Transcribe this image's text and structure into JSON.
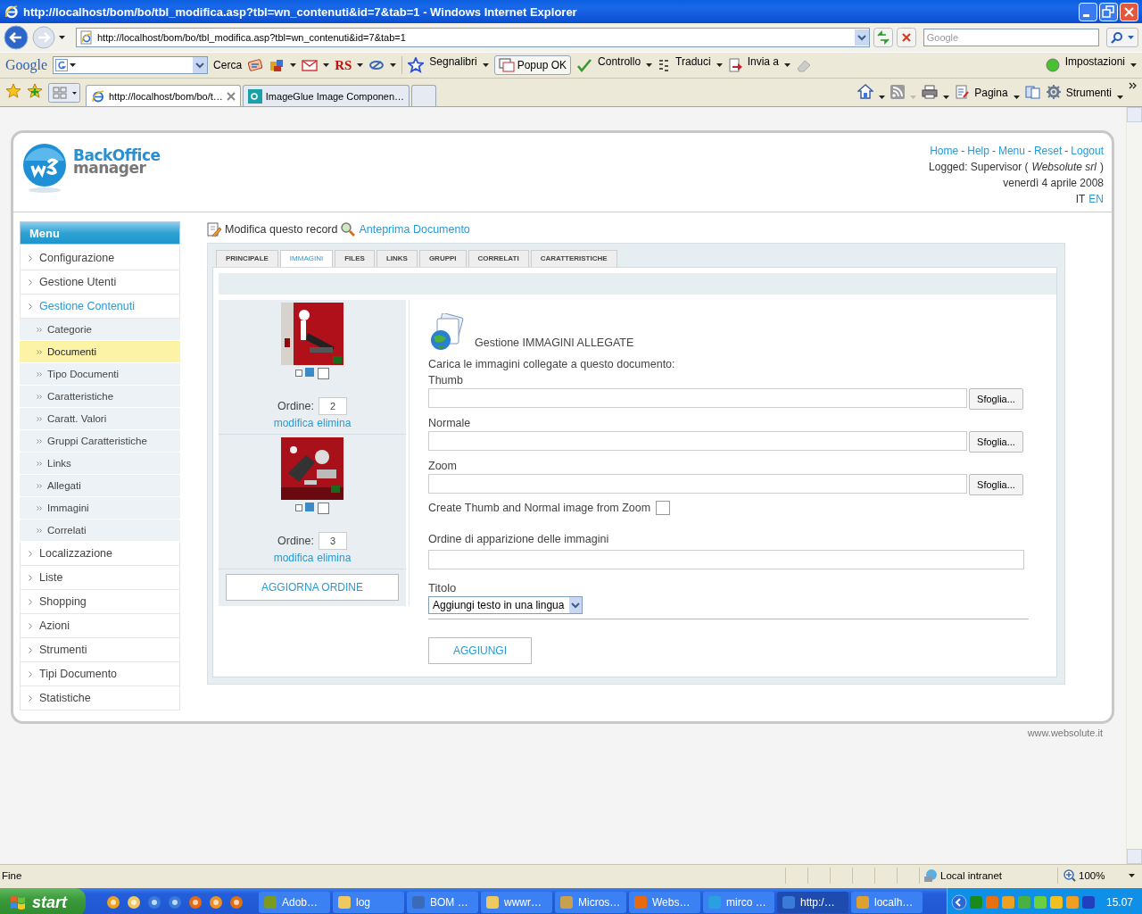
{
  "window": {
    "title": "http://localhost/bom/bo/tbl_modifica.asp?tbl=wn_contenuti&id=7&tab=1 - Windows Internet Explorer"
  },
  "nav": {
    "address": "http://localhost/bom/bo/tbl_modifica.asp?tbl=wn_contenuti&id=7&tab=1",
    "search_placeholder": "Google"
  },
  "google_toolbar": {
    "logo": "Google",
    "search_button": "Cerca",
    "rs": "RS",
    "items": [
      {
        "label": "Segnalibri",
        "kind": "menu"
      },
      {
        "label": "Popup OK",
        "kind": "button"
      },
      {
        "label": "Controllo",
        "kind": "menu"
      },
      {
        "label": "Traduci",
        "kind": "menu"
      },
      {
        "label": "Invia a",
        "kind": "menu"
      }
    ],
    "settings": "Impostazioni"
  },
  "tabs": [
    {
      "label": "http://localhost/bom/bo/t…",
      "selected": true
    },
    {
      "label": "ImageGlue Image Componen…",
      "selected": false
    }
  ],
  "command_bar": [
    {
      "label": "Pagina"
    },
    {
      "label": "Strumenti"
    }
  ],
  "header": {
    "logo_top": "BackOffice",
    "logo_bottom": "manager",
    "links": [
      {
        "label": "Home",
        "kind": "link"
      },
      {
        "label": "-",
        "kind": "separator"
      },
      {
        "label": "Help",
        "kind": "link"
      },
      {
        "label": "-",
        "kind": "separator"
      },
      {
        "label": "Menu",
        "kind": "link"
      },
      {
        "label": "-",
        "kind": "separator"
      },
      {
        "label": "Reset",
        "kind": "link"
      },
      {
        "label": "-",
        "kind": "separator"
      },
      {
        "label": "Logout",
        "kind": "link"
      }
    ],
    "logged": "Logged: Supervisor (*Websolute srl*)",
    "date": "venerdì 4 aprile 2008",
    "languages": [
      {
        "label": "IT",
        "selected": true
      },
      {
        "label": "EN",
        "selected": false
      }
    ]
  },
  "menu": {
    "title": "Menu",
    "items": [
      {
        "label": "Configurazione",
        "selected": false
      },
      {
        "label": "Gestione Utenti",
        "selected": false
      },
      {
        "label": "Gestione Contenuti",
        "selected": true,
        "children": [
          {
            "label": "Categorie",
            "selected": false
          },
          {
            "label": "Documenti",
            "selected": true
          },
          {
            "label": "Tipo Documenti",
            "selected": false
          },
          {
            "label": "Caratteristiche",
            "selected": false
          },
          {
            "label": "Caratt. Valori",
            "selected": false
          },
          {
            "label": "Gruppi Caratteristiche",
            "selected": false
          },
          {
            "label": "Links",
            "selected": false
          },
          {
            "label": "Allegati",
            "selected": false
          },
          {
            "label": "Immagini",
            "selected": false
          },
          {
            "label": "Correlati",
            "selected": false
          }
        ]
      },
      {
        "label": "Localizzazione",
        "selected": false
      },
      {
        "label": "Liste",
        "selected": false
      },
      {
        "label": "Shopping",
        "selected": false
      },
      {
        "label": "Azioni",
        "selected": false
      },
      {
        "label": "Strumenti",
        "selected": false
      },
      {
        "label": "Tipi Documento",
        "selected": false
      },
      {
        "label": "Statistiche",
        "selected": false
      }
    ]
  },
  "record_toolbar": {
    "edit": "Modifica questo record",
    "preview": "Anteprima Documento"
  },
  "record_tabs": [
    {
      "label": "PRINCIPALE",
      "selected": false
    },
    {
      "label": "IMMAGINI",
      "selected": true
    },
    {
      "label": "FILES",
      "selected": false
    },
    {
      "label": "LINKS",
      "selected": false
    },
    {
      "label": "GRUPPI",
      "selected": false
    },
    {
      "label": "CORRELATI",
      "selected": false
    },
    {
      "label": "CARATTERISTICHE",
      "selected": false
    }
  ],
  "images": [
    {
      "kind": "picture",
      "order_label": "Ordine:",
      "order": "2",
      "edit": "modifica",
      "delete": "elimina"
    },
    {
      "kind": "picture",
      "order_label": "Ordine:",
      "order": "3",
      "edit": "modifica",
      "delete": "elimina"
    }
  ],
  "update_order_button": "AGGIORNA ORDINE",
  "form": {
    "heading": "Gestione IMMAGINI ALLEGATE",
    "intro": "Carica le immagini collegate a questo documento:",
    "files": [
      {
        "label": "Thumb",
        "button": "Sfoglia..."
      },
      {
        "label": "Normale",
        "button": "Sfoglia..."
      },
      {
        "label": "Zoom",
        "button": "Sfoglia..."
      }
    ],
    "create_from_zoom": {
      "label": "Create Thumb and Normal image from Zoom",
      "checked": false
    },
    "order_label": "Ordine di apparizione delle immagini",
    "title_label": "Titolo",
    "title_select": "Aggiungi testo in una lingua",
    "add_button": "AGGIUNGI"
  },
  "footer": "www.websolute.it",
  "status_bar": {
    "text": "Fine",
    "zone": "Local intranet",
    "zoom": "100%"
  },
  "taskbar": {
    "start": "start",
    "tasks": [
      {
        "label": "Adob…",
        "selected": false
      },
      {
        "label": "log",
        "selected": false
      },
      {
        "label": "BOM …",
        "selected": false
      },
      {
        "label": "wwwr…",
        "selected": false
      },
      {
        "label": "Micros…",
        "selected": false
      },
      {
        "label": "Webs…",
        "selected": false
      },
      {
        "label": "mirco …",
        "selected": false
      },
      {
        "label": "http:/…",
        "selected": true
      },
      {
        "label": "localh…",
        "selected": false
      }
    ],
    "clock": "15.07"
  }
}
